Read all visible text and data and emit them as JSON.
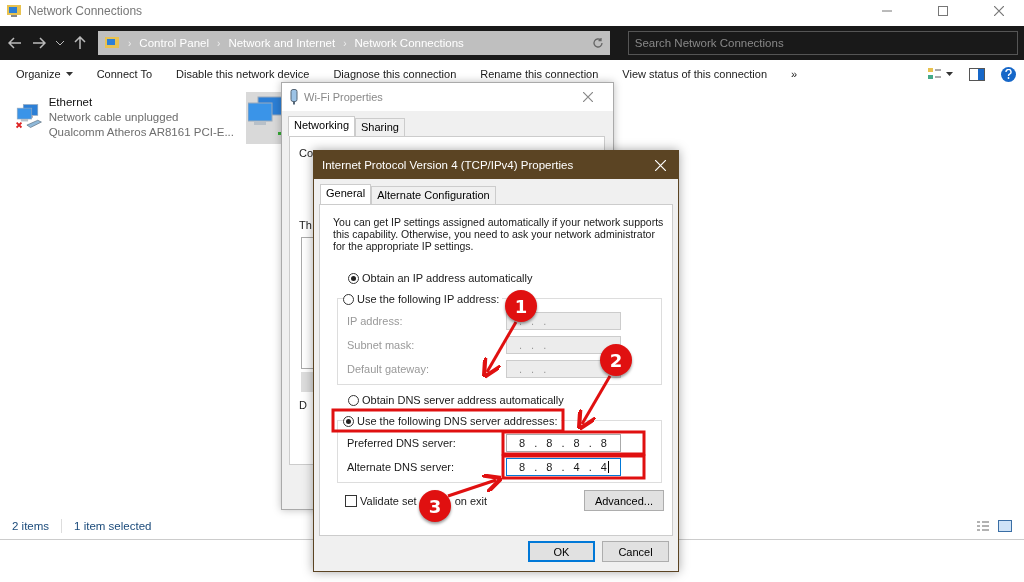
{
  "window": {
    "title": "Network Connections"
  },
  "address_bar": {
    "separator": "›",
    "path": [
      "Control Panel",
      "Network and Internet",
      "Network Connections"
    ],
    "search_placeholder": "Search Network Connections"
  },
  "command_bar": {
    "items": [
      {
        "label": "Organize",
        "dropdown": true
      },
      {
        "label": "Connect To",
        "dropdown": false
      },
      {
        "label": "Disable this network device",
        "dropdown": false
      },
      {
        "label": "Diagnose this connection",
        "dropdown": false
      },
      {
        "label": "Rename this connection",
        "dropdown": false
      },
      {
        "label": "View status of this connection",
        "dropdown": false
      }
    ],
    "overflow": "»"
  },
  "connections": [
    {
      "name": "Ethernet",
      "status": "Network cable unplugged",
      "device": "Qualcomm Atheros AR8161 PCI-E...",
      "selected": false
    },
    {
      "selected": true
    }
  ],
  "status_bar": {
    "item_count": "2 items",
    "selection": "1 item selected"
  },
  "wifi_dialog": {
    "title": "Wi-Fi Properties",
    "tabs": [
      {
        "label": "Networking",
        "selected": true
      },
      {
        "label": "Sharing",
        "selected": false
      }
    ],
    "fragment_connect": "Co",
    "fragment_list": "Th",
    "fragment_group": "D"
  },
  "ipv4_dialog": {
    "title": "Internet Protocol Version 4 (TCP/IPv4) Properties",
    "tabs": [
      {
        "label": "General",
        "selected": true
      },
      {
        "label": "Alternate Configuration",
        "selected": false
      }
    ],
    "description": "You can get IP settings assigned automatically if your network supports this capability. Otherwise, you need to ask your network administrator for the appropriate IP settings.",
    "ip_auto": {
      "label": "Obtain an IP address automatically",
      "selected": true
    },
    "ip_manual": {
      "label": "Use the following IP address:",
      "selected": false
    },
    "ip_fields": [
      {
        "label": "IP address:",
        "value": ". . .",
        "disabled": true
      },
      {
        "label": "Subnet mask:",
        "value": ". . .",
        "disabled": true
      },
      {
        "label": "Default gateway:",
        "value": ". . .",
        "disabled": true
      }
    ],
    "dns_auto": {
      "label": "Obtain DNS server address automatically",
      "selected": false
    },
    "dns_manual": {
      "label": "Use the following DNS server addresses:",
      "selected": true
    },
    "dns_fields": [
      {
        "label": "Preferred DNS server:",
        "value": "8 . 8 . 8 . 8",
        "focused": false
      },
      {
        "label": "Alternate DNS server:",
        "value": "8 . 8 . 4 . 4",
        "focused": true
      }
    ],
    "validate": {
      "label_start": "Validate set",
      "label_end": "on exit",
      "checked": false
    },
    "advanced_button": "Advanced...",
    "buttons": [
      {
        "label": "OK",
        "default": true
      },
      {
        "label": "Cancel",
        "default": false
      }
    ]
  },
  "markers": [
    {
      "number": "1"
    },
    {
      "number": "2"
    },
    {
      "number": "3"
    }
  ]
}
